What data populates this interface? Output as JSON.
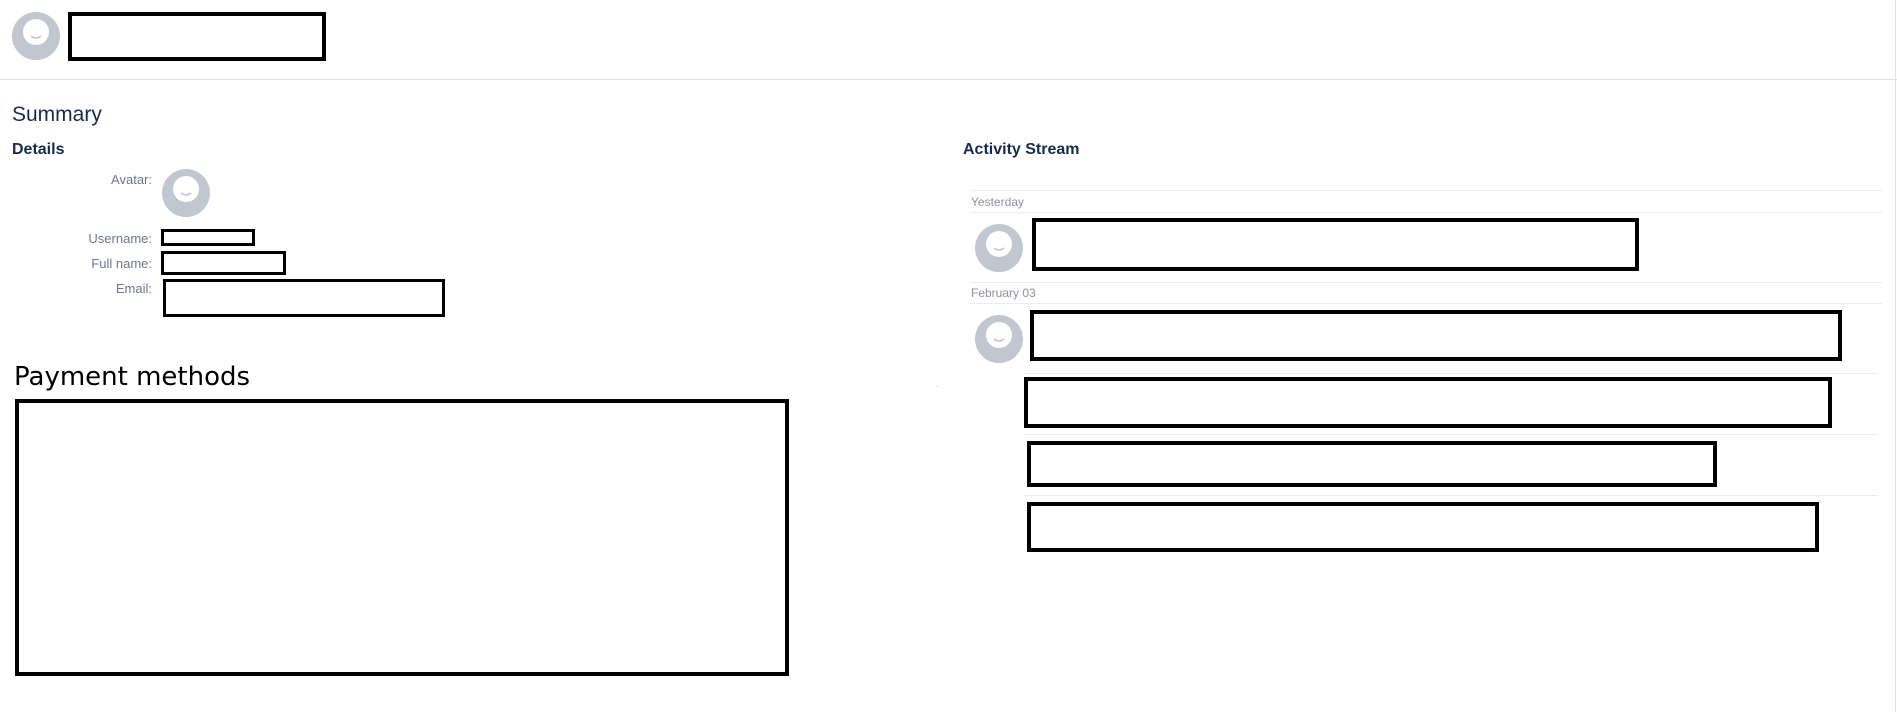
{
  "header": {
    "user_name": ""
  },
  "summary": {
    "title": "Summary",
    "details": {
      "title": "Details",
      "avatar_label": "Avatar:",
      "username_label": "Username:",
      "username_value": "",
      "fullname_label": "Full name:",
      "fullname_value": "",
      "email_label": "Email:",
      "email_value": ""
    }
  },
  "payment": {
    "title": "Payment methods",
    "content": ""
  },
  "activity": {
    "title": "Activity Stream",
    "groups": [
      {
        "date": "Yesterday",
        "entries": [
          ""
        ]
      },
      {
        "date": "February 03",
        "entries": [
          "",
          "",
          "",
          ""
        ]
      }
    ]
  },
  "colors": {
    "text_primary": "#172b4d",
    "text_secondary": "#6b778c",
    "date_text": "#8993a4",
    "avatar_bg": "#c1c7d0",
    "divider": "#dfe1e6",
    "redaction": "#000000"
  },
  "icons": {
    "avatar": "default-user-avatar-icon"
  }
}
